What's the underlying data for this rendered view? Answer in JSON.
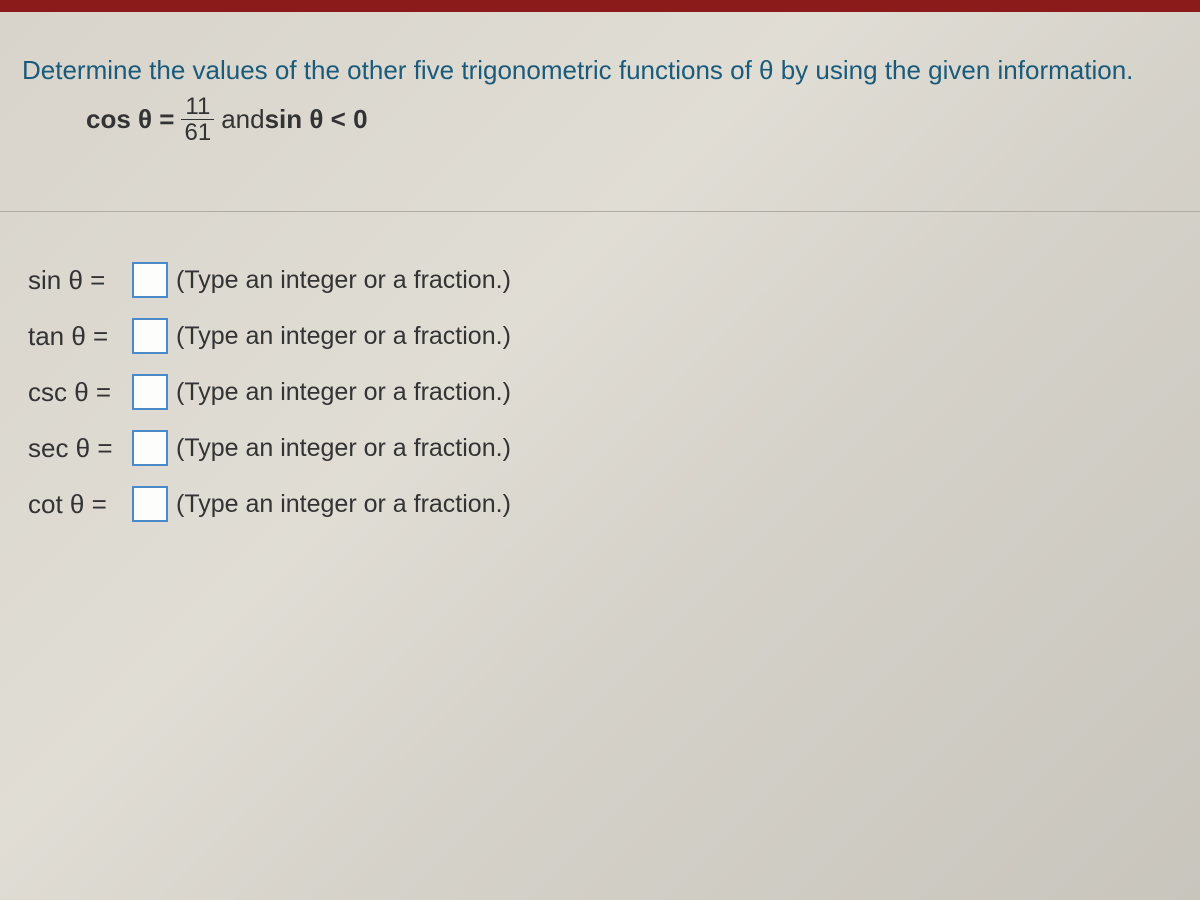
{
  "question": {
    "prompt": "Determine the values of the other five trigonometric functions of θ by using the given information.",
    "given_prefix": "cos θ =",
    "frac_num": "11",
    "frac_den": "61",
    "given_middle": " and ",
    "given_sin": "sin θ < 0"
  },
  "answers": [
    {
      "label": "sin θ =",
      "hint": "(Type an integer or a fraction.)",
      "value": ""
    },
    {
      "label": "tan θ =",
      "hint": "(Type an integer or a fraction.)",
      "value": ""
    },
    {
      "label": "csc θ =",
      "hint": "(Type an integer or a fraction.)",
      "value": ""
    },
    {
      "label": "sec θ =",
      "hint": "(Type an integer or a fraction.)",
      "value": ""
    },
    {
      "label": "cot θ =",
      "hint": "(Type an integer or a fraction.)",
      "value": ""
    }
  ]
}
